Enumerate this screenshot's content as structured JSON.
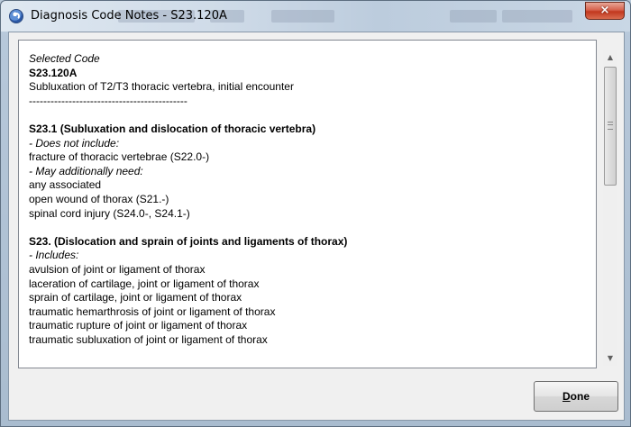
{
  "window": {
    "title": "Diagnosis Code Notes - S23.120A",
    "close_glyph": "×"
  },
  "notes": {
    "lines": [
      {
        "text": "Selected Code",
        "style": "italic"
      },
      {
        "text": "S23.120A",
        "style": "bold"
      },
      {
        "text": "Subluxation of T2/T3 thoracic vertebra, initial encounter",
        "style": "normal"
      },
      {
        "text": "--------------------------------------------",
        "style": "normal"
      },
      {
        "text": "",
        "style": "gap"
      },
      {
        "text": "S23.1 (Subluxation and dislocation of thoracic vertebra)",
        "style": "bold"
      },
      {
        "text": "- Does not include:",
        "style": "italic"
      },
      {
        "text": "fracture of thoracic vertebrae (S22.0-)",
        "style": "normal"
      },
      {
        "text": "- May additionally need:",
        "style": "italic"
      },
      {
        "text": "any associated",
        "style": "normal"
      },
      {
        "text": "open wound of thorax (S21.-)",
        "style": "normal"
      },
      {
        "text": "spinal cord injury (S24.0-, S24.1-)",
        "style": "normal"
      },
      {
        "text": "",
        "style": "gap"
      },
      {
        "text": "S23. (Dislocation and sprain of joints and ligaments of thorax)",
        "style": "bold"
      },
      {
        "text": "- Includes:",
        "style": "italic"
      },
      {
        "text": "avulsion of joint or ligament of thorax",
        "style": "normal"
      },
      {
        "text": "laceration of cartilage, joint or ligament of thorax",
        "style": "normal"
      },
      {
        "text": "sprain of cartilage, joint or ligament of thorax",
        "style": "normal"
      },
      {
        "text": "traumatic hemarthrosis of joint or ligament of thorax",
        "style": "normal"
      },
      {
        "text": "traumatic rupture of joint or ligament of thorax",
        "style": "normal"
      },
      {
        "text": "traumatic subluxation of joint or ligament of thorax",
        "style": "normal"
      }
    ]
  },
  "buttons": {
    "done_label": "Done",
    "done_mnemonic": "D"
  },
  "icons": {
    "scroll_up": "▲",
    "scroll_down": "▼"
  }
}
